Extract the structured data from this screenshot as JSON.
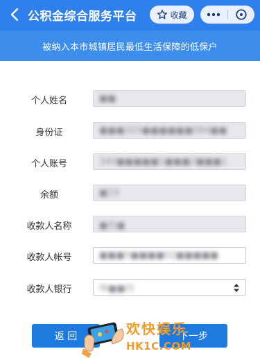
{
  "header": {
    "title": "公积金综合服务平台",
    "fav_label": "收藏",
    "icons": {
      "back": "chevron-left-icon",
      "favorite": "star-outline-icon",
      "more": "more-dots-icon",
      "close": "close-circle-icon"
    }
  },
  "banner": {
    "text": "被纳入本市城镇居民最低生活保障的低保户"
  },
  "form": {
    "fields": [
      {
        "label": "个人姓名",
        "value": "■■"
      },
      {
        "label": "身份证",
        "value": "■■■325■■■■■■084■■"
      },
      {
        "label": "个人账号",
        "value": "340■■■■■1■■■2■■■1"
      },
      {
        "label": "余额",
        "value": "■19"
      },
      {
        "label": "收款人名称",
        "value": "■仕■"
      },
      {
        "label": "收款人帐号",
        "value": "■■■5■■■■02■■■■■"
      },
      {
        "label": "收款人银行",
        "value": "中■■行"
      }
    ]
  },
  "buttons": {
    "back": "返 回",
    "next": "下一步"
  },
  "watermark": {
    "text_cn": "欢快娱乐",
    "text_en": "HK1C.COM"
  },
  "colors": {
    "header_bg": "#2f80ed",
    "banner_bg": "#3c8dec",
    "button_bg": "#1f7ae0",
    "watermark": "#f29b2b"
  }
}
